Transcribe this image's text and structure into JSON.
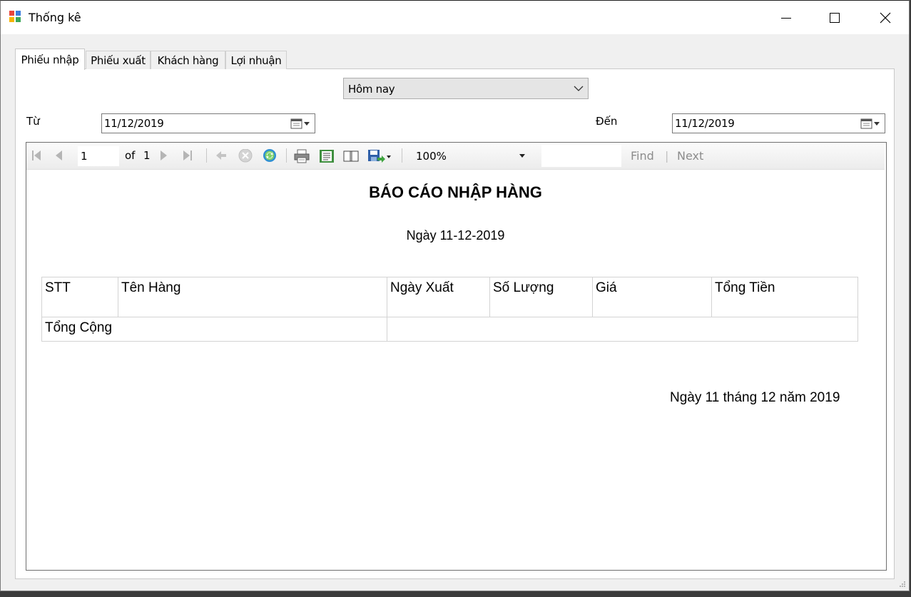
{
  "window": {
    "title": "Thống kê",
    "icon": "form-icon"
  },
  "tabs": [
    {
      "label": "Phiếu nhập",
      "active": true
    },
    {
      "label": "Phiếu xuất",
      "active": false
    },
    {
      "label": "Khách hàng",
      "active": false
    },
    {
      "label": "Lợi nhuận",
      "active": false
    }
  ],
  "filter": {
    "period_selected": "Hôm nay",
    "from_label": "Từ",
    "from_date": "11/12/2019",
    "to_label": "Đến",
    "to_date": "11/12/2019"
  },
  "report_toolbar": {
    "current_page": "1",
    "of_label": "of",
    "total_pages": "1",
    "zoom": "100%",
    "find_label": "Find",
    "separator": "|",
    "next_label": "Next"
  },
  "report": {
    "title": "BÁO CÁO NHẬP HÀNG",
    "date_line": "Ngày 11-12-2019",
    "columns": [
      "STT",
      "Tên Hàng",
      "Ngày Xuất",
      "Số Lượng",
      "Giá",
      "Tổng Tiền"
    ],
    "total_label": "Tổng Cộng",
    "signature_date": "Ngày 11 tháng 12 năm 2019"
  }
}
